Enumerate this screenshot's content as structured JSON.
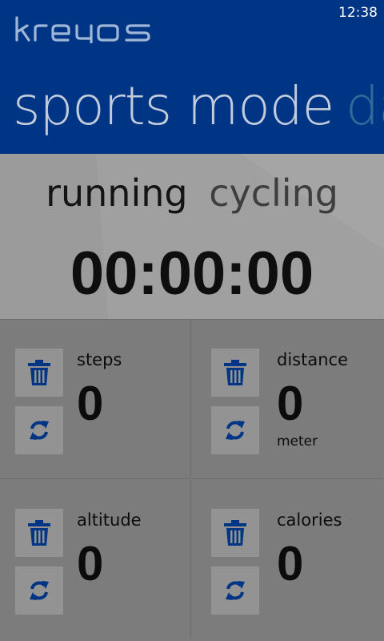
{
  "status_bar": {
    "time": "12:38"
  },
  "app": {
    "brand": "kreyos"
  },
  "pivot": {
    "active": "sports mode",
    "next": "da"
  },
  "mode": {
    "options": [
      "running",
      "cycling"
    ],
    "selected": "running",
    "timer": "00:00:00"
  },
  "stats": [
    {
      "label": "steps",
      "value": "0",
      "unit": ""
    },
    {
      "label": "distance",
      "value": "0",
      "unit": "meter"
    },
    {
      "label": "altitude",
      "value": "0",
      "unit": ""
    },
    {
      "label": "calories",
      "value": "0",
      "unit": ""
    }
  ],
  "colors": {
    "header": "#003585",
    "icon": "#003585",
    "tile_button": "#939393",
    "panel": "#9b9b9b",
    "background": "#7c7c7c"
  },
  "icons": {
    "reset": "trash-icon",
    "sync": "refresh-icon"
  }
}
